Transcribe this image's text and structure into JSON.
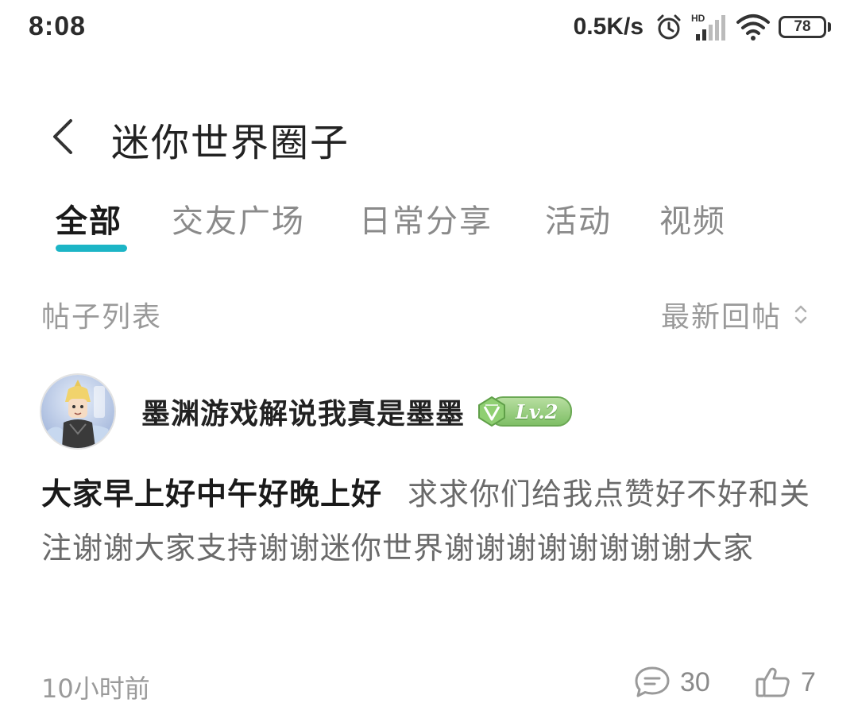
{
  "status_bar": {
    "time": "8:08",
    "net_speed": "0.5K/s",
    "signal_label": "HD",
    "battery_level": "78",
    "icons": [
      "alarm-icon",
      "hd-signal-icon",
      "wifi-icon",
      "battery-icon"
    ]
  },
  "header": {
    "title": "迷你世界圈子",
    "back_icon": "chevron-left-icon"
  },
  "tabs": [
    {
      "label": "全部",
      "active": true
    },
    {
      "label": "交友广场",
      "active": false
    },
    {
      "label": "日常分享",
      "active": false
    },
    {
      "label": "活动",
      "active": false
    },
    {
      "label": "视频",
      "active": false
    }
  ],
  "list_header": {
    "title": "帖子列表",
    "sort_label": "最新回帖",
    "sort_icon": "sort-updown-icon"
  },
  "post": {
    "author": "墨渊游戏解说我真是墨墨",
    "level": "Lv.2",
    "title": "大家早上好中午好晚上好",
    "content": "求求你们给我点赞好不好和关注谢谢大家支持谢谢迷你世界谢谢谢谢谢谢谢谢大家",
    "time": "10小时前",
    "comments": "30",
    "likes": "7"
  },
  "colors": {
    "accent": "#1cb5c6",
    "level_badge": "#7fbf66",
    "muted_text": "#9a9a9a"
  }
}
